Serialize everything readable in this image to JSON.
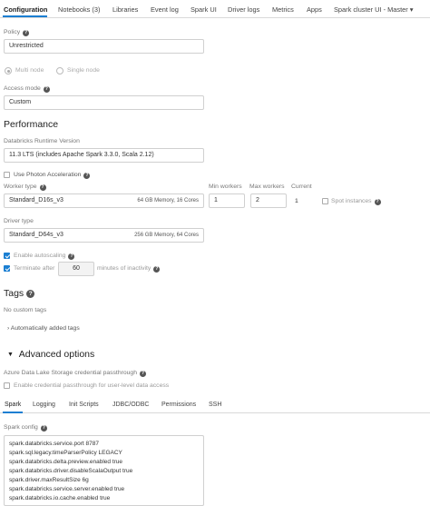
{
  "tabs": [
    {
      "label": "Configuration",
      "active": true
    },
    {
      "label": "Notebooks (3)"
    },
    {
      "label": "Libraries"
    },
    {
      "label": "Event log"
    },
    {
      "label": "Spark UI"
    },
    {
      "label": "Driver logs"
    },
    {
      "label": "Metrics"
    },
    {
      "label": "Apps"
    },
    {
      "label": "Spark cluster UI - Master"
    }
  ],
  "policy": {
    "label": "Policy",
    "value": "Unrestricted"
  },
  "node_mode": {
    "multi": "Multi node",
    "single": "Single node",
    "selected": "multi"
  },
  "access_mode": {
    "label": "Access mode",
    "value": "Custom"
  },
  "performance": {
    "heading": "Performance",
    "runtime_label": "Databricks Runtime Version",
    "runtime_value": "11.3 LTS (includes Apache Spark 3.3.0, Scala 2.12)",
    "photon_label": "Use Photon Acceleration",
    "photon_checked": false,
    "worker_type_label": "Worker type",
    "worker_type_value": "Standard_D16s_v3",
    "worker_type_spec": "64 GB Memory, 16 Cores",
    "min_workers_label": "Min workers",
    "min_workers_value": "1",
    "max_workers_label": "Max workers",
    "max_workers_value": "2",
    "current_label": "Current",
    "current_value": "1",
    "spot_label": "Spot instances",
    "driver_type_label": "Driver type",
    "driver_type_value": "Standard_D64s_v3",
    "driver_type_spec": "256 GB Memory, 64 Cores",
    "autoscaling_label": "Enable autoscaling",
    "autoscaling_checked": true,
    "terminate_prefix": "Terminate after",
    "terminate_value": "60",
    "terminate_suffix": "minutes of inactivity",
    "terminate_checked": true
  },
  "tags": {
    "heading": "Tags",
    "empty_text": "No custom tags",
    "auto_added": "Automatically added tags"
  },
  "advanced": {
    "heading": "Advanced options",
    "adls_label": "Azure Data Lake Storage credential passthrough",
    "adls_checkbox_label": "Enable credential passthrough for user-level data access",
    "subtabs": [
      {
        "label": "Spark",
        "active": true
      },
      {
        "label": "Logging"
      },
      {
        "label": "Init Scripts"
      },
      {
        "label": "JDBC/ODBC"
      },
      {
        "label": "Permissions"
      },
      {
        "label": "SSH"
      }
    ],
    "spark_config_label": "Spark config",
    "spark_config_lines": [
      "spark.databricks.service.port 8787",
      "spark.sql.legacy.timeParserPolicy LEGACY",
      "spark.databricks.delta.preview.enabled true",
      "spark.databricks.driver.disableScalaOutput true",
      "spark.driver.maxResultSize 6g",
      "spark.databricks.service.server.enabled true",
      "spark.databricks.io.cache.enabled true"
    ]
  },
  "icons": {
    "help": "?",
    "chevron_right": "›",
    "triangle_down": "▼",
    "caret_down": "▾"
  }
}
